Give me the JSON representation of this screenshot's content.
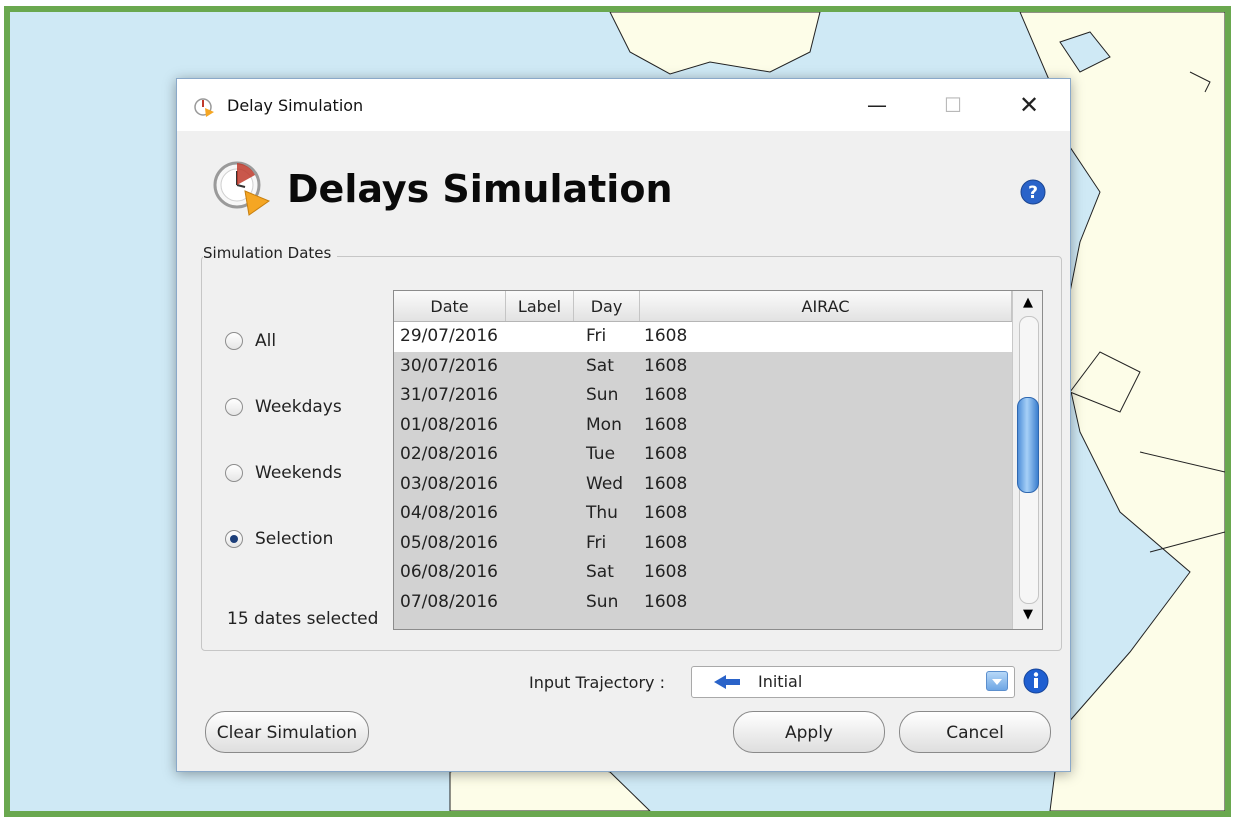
{
  "window": {
    "title": "Delay Simulation",
    "min_glyph": "—",
    "max_glyph": "☐",
    "close_glyph": "✕"
  },
  "header": {
    "title": "Delays Simulation"
  },
  "simulation_dates": {
    "group_label": "Simulation Dates",
    "options": [
      {
        "label": "All",
        "selected": false
      },
      {
        "label": "Weekdays",
        "selected": false
      },
      {
        "label": "Weekends",
        "selected": false
      },
      {
        "label": "Selection",
        "selected": true
      }
    ],
    "count_text": "15 dates selected"
  },
  "table": {
    "columns": [
      "Date",
      "Label",
      "Day",
      "AIRAC"
    ],
    "rows": [
      {
        "date": "29/07/2016",
        "label": "",
        "day": "Fri",
        "airac": "1608",
        "selected": true
      },
      {
        "date": "30/07/2016",
        "label": "",
        "day": "Sat",
        "airac": "1608"
      },
      {
        "date": "31/07/2016",
        "label": "",
        "day": "Sun",
        "airac": "1608"
      },
      {
        "date": "01/08/2016",
        "label": "",
        "day": "Mon",
        "airac": "1608"
      },
      {
        "date": "02/08/2016",
        "label": "",
        "day": "Tue",
        "airac": "1608"
      },
      {
        "date": "03/08/2016",
        "label": "",
        "day": "Wed",
        "airac": "1608"
      },
      {
        "date": "04/08/2016",
        "label": "",
        "day": "Thu",
        "airac": "1608"
      },
      {
        "date": "05/08/2016",
        "label": "",
        "day": "Fri",
        "airac": "1608"
      },
      {
        "date": "06/08/2016",
        "label": "",
        "day": "Sat",
        "airac": "1608"
      },
      {
        "date": "07/08/2016",
        "label": "",
        "day": "Sun",
        "airac": "1608"
      }
    ]
  },
  "trajectory": {
    "label": "Input Trajectory :",
    "value": "Initial"
  },
  "buttons": {
    "clear": "Clear Simulation",
    "apply": "Apply",
    "cancel": "Cancel"
  },
  "icons": {
    "app": "clock-arrow-icon",
    "header": "clock-arrow-icon",
    "help": "help-icon",
    "info": "info-icon",
    "trajectory": "trajectory-icon",
    "scroll_up": "scroll-up-arrow-icon",
    "scroll_down": "scroll-down-arrow-icon"
  },
  "colors": {
    "frame_border": "#6aa84f",
    "sea": "#cfe9f5",
    "land": "#fdfde8",
    "accent": "#2a63c9"
  }
}
